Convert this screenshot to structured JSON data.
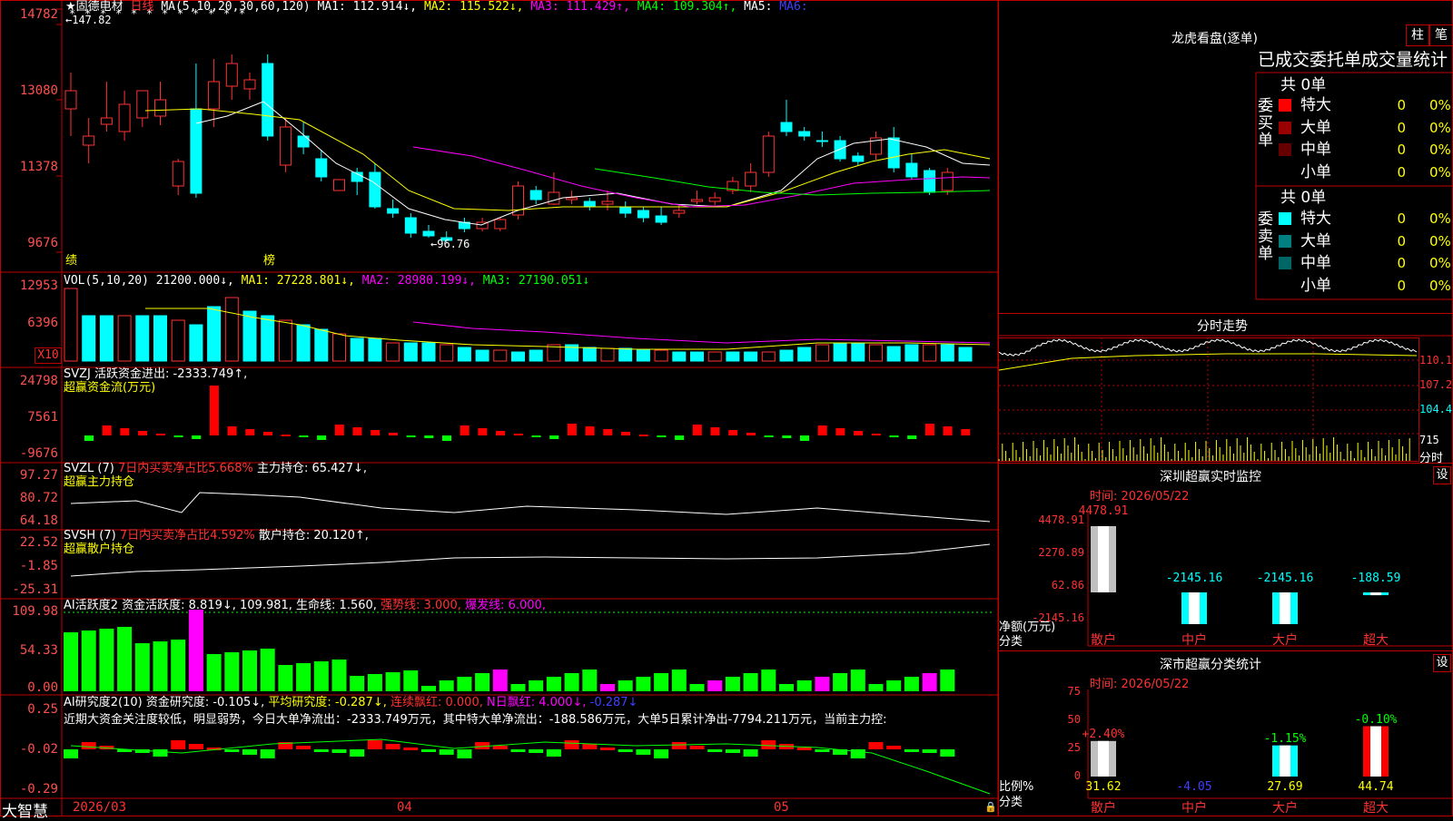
{
  "header": {
    "stock_name": "★固德电材",
    "period": "日线",
    "ma_title": "MA(5,10,20,30,60,120)",
    "ma1": "MA1: 112.914↓,",
    "ma2": "MA2: 115.522↓,",
    "ma3": "MA3: 111.429↑,",
    "ma4": "MA4: 109.304↑,",
    "ma5": "MA5:",
    "ma6": "MA6:",
    "high_mark": "147.82",
    "low_mark": "96.76",
    "tag_ji": "绩",
    "tag_bang": "榜"
  },
  "price_axis": [
    "14782",
    "13080",
    "11378",
    "9676"
  ],
  "vol_panel": {
    "title": "VOL(5,10,20)",
    "value": "21200.000↓,",
    "ma1": "MA1: 27228.801↓,",
    "ma2": "MA2: 28980.199↓,",
    "ma3": "MA3: 27190.051↓",
    "axis": [
      "12953",
      "6396"
    ],
    "unit": "X10"
  },
  "svzj_panel": {
    "title": "SVZJ  活跃资金进出: -2333.749↑,",
    "subtitle": "超赢资金流(万元)",
    "axis": [
      "24798",
      "7561",
      "-9676"
    ]
  },
  "svzl_panel": {
    "title": "SVZL (7)",
    "ratio": "7日内买卖净占比5.668%",
    "hold": "主力持仓: 65.427↓,",
    "subtitle": "超赢主力持仓",
    "axis": [
      "97.27",
      "80.72",
      "64.18"
    ]
  },
  "svsh_panel": {
    "title": "SVSH (7)",
    "ratio": "7日内买卖净占比4.592%",
    "hold": "散户持仓: 20.120↑,",
    "subtitle": "超赢散户持仓",
    "axis": [
      "22.52",
      "-1.85",
      "-25.31"
    ]
  },
  "ai_active_panel": {
    "title": "AI活跃度2 资金活跃度: 8.819↓, 109.981, 生命线: 1.560,",
    "strong": "强势线: 3.000,",
    "burst": "爆发线: 6.000,",
    "axis": [
      "109.98",
      "54.33",
      "0.00"
    ]
  },
  "ai_research_panel": {
    "title": "AI研究度2(10) 资金研究度: -0.105↓,",
    "avg": "平均研究度: -0.287↓,",
    "red": "连续飘红: 0.000,",
    "nred": "N日飘红: 4.000↓,",
    "last": "-0.287↓",
    "desc": "近期大资金关注度较低，明显弱势，今日大单净流出：-2333.749万元，其中特大单净流出：-188.586万元，大单5日累计净出-7794.211万元，当前主力控:",
    "axis": [
      "0.25",
      "-0.02",
      "-0.29"
    ]
  },
  "bottom_axis": {
    "brand": "大智慧",
    "dates": [
      "2026/03",
      "04",
      "05"
    ]
  },
  "dragon_panel": {
    "title": "龙虎看盘(逐单)",
    "tab1": "柱",
    "tab2": "笔",
    "header": "已成交委托单成交量统计",
    "buy_label": "委买单",
    "sell_label": "委卖单",
    "buy_total": "共 0单",
    "sell_total": "共 0单",
    "buy_rows": [
      {
        "label": "特大",
        "count": "0",
        "pct": "0%",
        "color": "#ff0000"
      },
      {
        "label": "大单",
        "count": "0",
        "pct": "0%",
        "color": "#990000"
      },
      {
        "label": "中单",
        "count": "0",
        "pct": "0%",
        "color": "#660000"
      },
      {
        "label": "小单",
        "count": "0",
        "pct": "0%",
        "color": ""
      }
    ],
    "sell_rows": [
      {
        "label": "特大",
        "count": "0",
        "pct": "0%",
        "color": "#00ffff"
      },
      {
        "label": "大单",
        "count": "0",
        "pct": "0%",
        "color": "#008080"
      },
      {
        "label": "中单",
        "count": "0",
        "pct": "0%",
        "color": "#006666"
      },
      {
        "label": "小单",
        "count": "0",
        "pct": "0%",
        "color": ""
      }
    ]
  },
  "intraday_panel": {
    "title": "分时走势",
    "axis": [
      "110.1",
      "107.2",
      "104.4",
      "715"
    ],
    "unit": "分时"
  },
  "sz_monitor": {
    "title": "深圳超赢实时监控",
    "set": "设",
    "time": "时间: 2026/05/22",
    "axis": [
      "4478.91",
      "2270.89",
      "62.86",
      "-2145.16"
    ],
    "ylabel1": "净额(万元)",
    "ylabel2": "分类",
    "bars": [
      {
        "label": "散户",
        "value": 4478.91,
        "text": "4478.91"
      },
      {
        "label": "中户",
        "value": -2145.16,
        "text": "-2145.16"
      },
      {
        "label": "大户",
        "value": -2145.16,
        "text": "-2145.16"
      },
      {
        "label": "超大",
        "value": -188.59,
        "text": "-188.59"
      }
    ]
  },
  "sz_class": {
    "title": "深市超赢分类统计",
    "set": "设",
    "time": "时间: 2026/05/22",
    "axis": [
      "75",
      "50",
      "25",
      "0"
    ],
    "ylabel1": "比例%",
    "ylabel2": "分类",
    "bars": [
      {
        "label": "散户",
        "value": 31.62,
        "text": "31.62",
        "delta": "+2.40%"
      },
      {
        "label": "中户",
        "value": -4.05,
        "text": "-4.05",
        "delta": ""
      },
      {
        "label": "大户",
        "value": 27.69,
        "text": "27.69",
        "delta": "-1.15%"
      },
      {
        "label": "超大",
        "value": 44.74,
        "text": "44.74",
        "delta": "-0.10%"
      }
    ]
  },
  "colors": {
    "up": "#ff3232",
    "down": "#00ffff",
    "grid": "#c00000",
    "ma1": "#ffffff",
    "ma2": "#ffff00",
    "ma3": "#ff00ff",
    "ma4": "#00ff00"
  }
}
